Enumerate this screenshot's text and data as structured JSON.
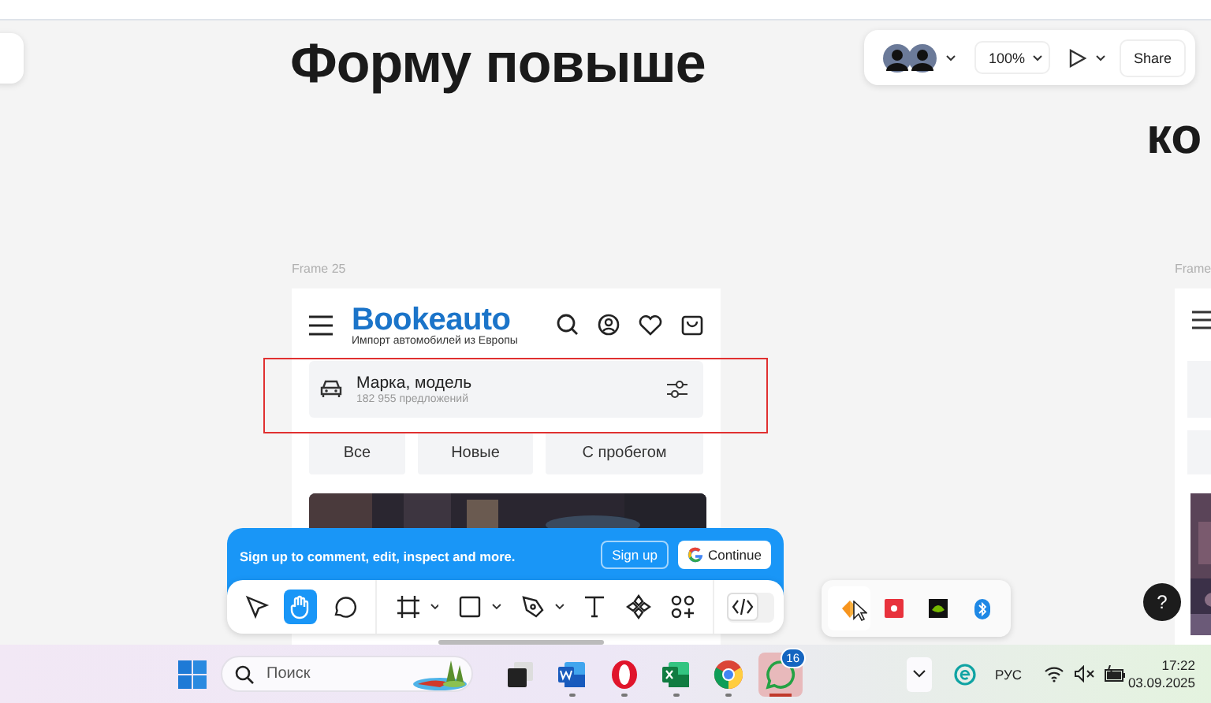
{
  "canvas": {
    "heading": "Форму повыше",
    "right_heading": "ко",
    "right_frame_label": "Frame",
    "frame_label": "Frame 25"
  },
  "top_toolbar": {
    "zoom": "100%",
    "share": "Share"
  },
  "app": {
    "brand": "Bookeauto",
    "tagline": "Импорт автомобилей из Европы",
    "search_title": "Марка, модель",
    "search_count": "182 955 предложений",
    "chips": [
      "Все",
      "Новые",
      "С пробегом"
    ]
  },
  "signup_banner": {
    "text": "Sign up to comment, edit, inspect and more.",
    "signup": "Sign up",
    "continue": "Continue"
  },
  "tools": [
    {
      "kind": "move",
      "selected": false,
      "menu": false
    },
    {
      "kind": "hand",
      "selected": true,
      "menu": false
    },
    {
      "kind": "comment",
      "selected": false,
      "menu": false
    },
    {
      "kind": "frame",
      "selected": false,
      "menu": true
    },
    {
      "kind": "rectangle",
      "selected": false,
      "menu": true
    },
    {
      "kind": "pen",
      "selected": false,
      "menu": true
    },
    {
      "kind": "text",
      "selected": false,
      "menu": false
    },
    {
      "kind": "component",
      "selected": false,
      "menu": false
    },
    {
      "kind": "assets",
      "selected": false,
      "menu": false
    }
  ],
  "dev_mode": false,
  "help": "?",
  "tray_popup": [
    {
      "kind": "shapes"
    },
    {
      "kind": "record"
    },
    {
      "kind": "gpu"
    },
    {
      "kind": "bluetooth"
    }
  ],
  "taskbar": {
    "search_placeholder": "Поиск",
    "apps": [
      {
        "kind": "task-view",
        "running": false,
        "active": false
      },
      {
        "kind": "word",
        "running": true,
        "active": false
      },
      {
        "kind": "opera",
        "running": true,
        "active": false
      },
      {
        "kind": "excel",
        "running": true,
        "active": false
      },
      {
        "kind": "chrome",
        "running": true,
        "active": false
      },
      {
        "kind": "whatsapp",
        "running": false,
        "active": true,
        "badge": "16"
      }
    ],
    "language": "РУС",
    "time": "17:22",
    "date": "03.09.2025"
  }
}
